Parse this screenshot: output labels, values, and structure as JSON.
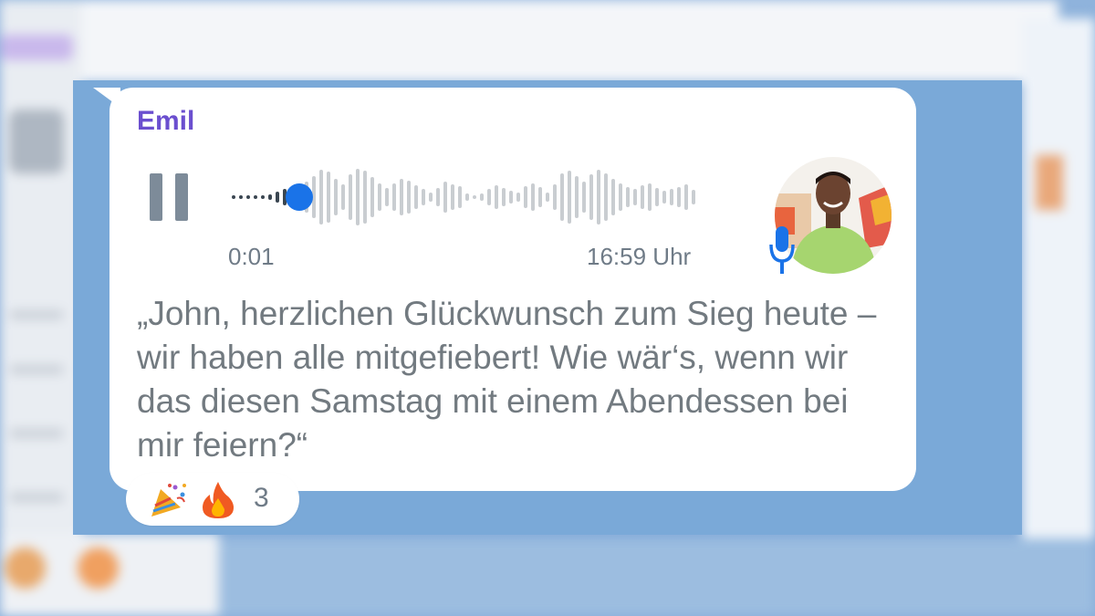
{
  "message": {
    "sender": "Emil",
    "audio": {
      "elapsed": "0:01",
      "progress": 0.14,
      "state": "playing"
    },
    "timestamp": "16:59 Uhr",
    "transcript": "„John, herzlichen Glückwunsch zum Sieg heute – wir haben alle mitgefiebert! Wie wär‘s, wenn wir das diesen Samstag mit einem Abendessen bei mir feiern?“",
    "reactions": {
      "icons": [
        "party-popper-icon",
        "fire-icon"
      ],
      "count": "3"
    }
  },
  "colors": {
    "sender": "#6b4fcf",
    "accent": "#1a73e8",
    "chat_background": "#7aa9d8",
    "bubble": "#ffffff"
  }
}
